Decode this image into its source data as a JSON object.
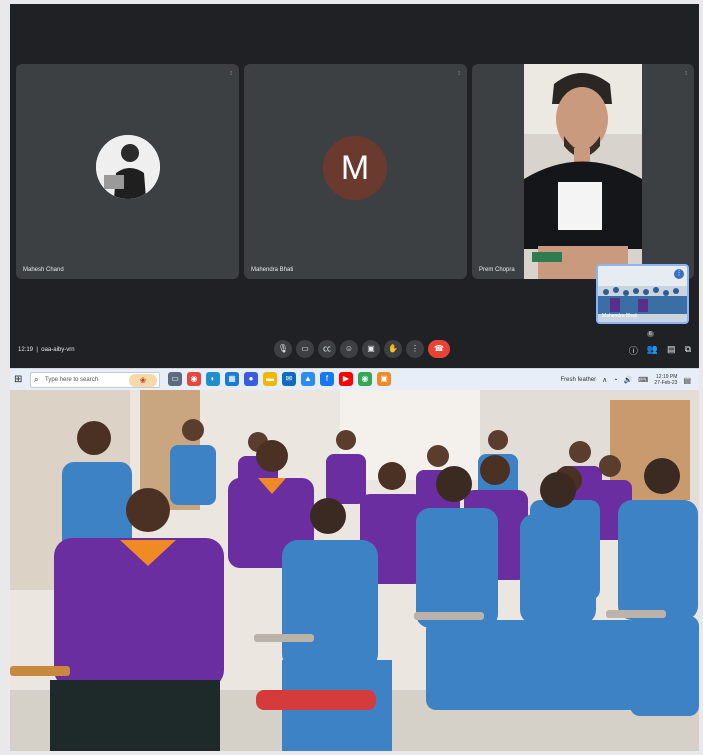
{
  "meet": {
    "participants": [
      {
        "name": "Mahesh Chand"
      },
      {
        "name": "Mahendra Bhati",
        "initial": "M"
      },
      {
        "name": "Prem Chopra"
      }
    ],
    "self_view": {
      "name": "Mahendra Bhati"
    },
    "meeting_time": "12:19",
    "meeting_code": "oaa-aiby-vrn",
    "participants_badge": "6",
    "controls": {
      "mic": "mic-icon",
      "camera": "camera-icon",
      "captions": "cc-icon",
      "emoji": "emoji-icon",
      "present": "present-icon",
      "raise_hand": "hand-icon",
      "more": "more-icon",
      "end": "end-call-icon"
    }
  },
  "taskbar": {
    "search_placeholder": "Type here to search",
    "weather": "Fresh feather",
    "time": "12:19 PM",
    "date": "27-Feb-23"
  },
  "colors": {
    "meet_bg": "#202124",
    "tile_bg": "#3c4043",
    "end_call": "#ea4335",
    "uniform_purple": "#6a2ea0",
    "uniform_blue": "#3d82c4",
    "collar_orange": "#f08a24",
    "taskbar_bg": "#e7eef7"
  }
}
